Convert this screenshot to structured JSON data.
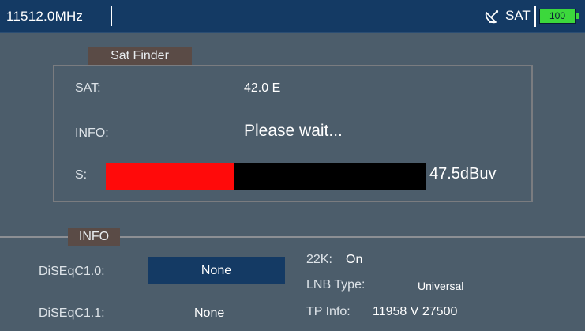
{
  "status_bar": {
    "frequency": "11512.0MHz",
    "mode": "SAT",
    "battery": "100",
    "satellite_icon": "satellite-dish-icon",
    "colors": {
      "bar": "#143a64",
      "battery": "#3cd83c"
    }
  },
  "sat_finder": {
    "title": "Sat Finder",
    "sat_label": "SAT:",
    "sat_value": "42.0 E",
    "info_label": "INFO:",
    "info_value": "Please wait...",
    "signal_label": "S:",
    "signal_value": "47.5dBuv",
    "signal_level_fraction": 0.4,
    "colors": {
      "signal_fill": "#ff0a0a",
      "signal_track": "#000000"
    }
  },
  "info": {
    "title": "INFO",
    "diseqc10_label": "DiSEqC1.0:",
    "diseqc10_value": "None",
    "diseqc11_label": "DiSEqC1.1:",
    "diseqc11_value": "None",
    "k22_label": "22K:",
    "k22_value": "On",
    "lnb_label": "LNB Type:",
    "lnb_value": "Universal",
    "tp_label": "TP Info:",
    "tp_value": "11958 V 27500"
  }
}
